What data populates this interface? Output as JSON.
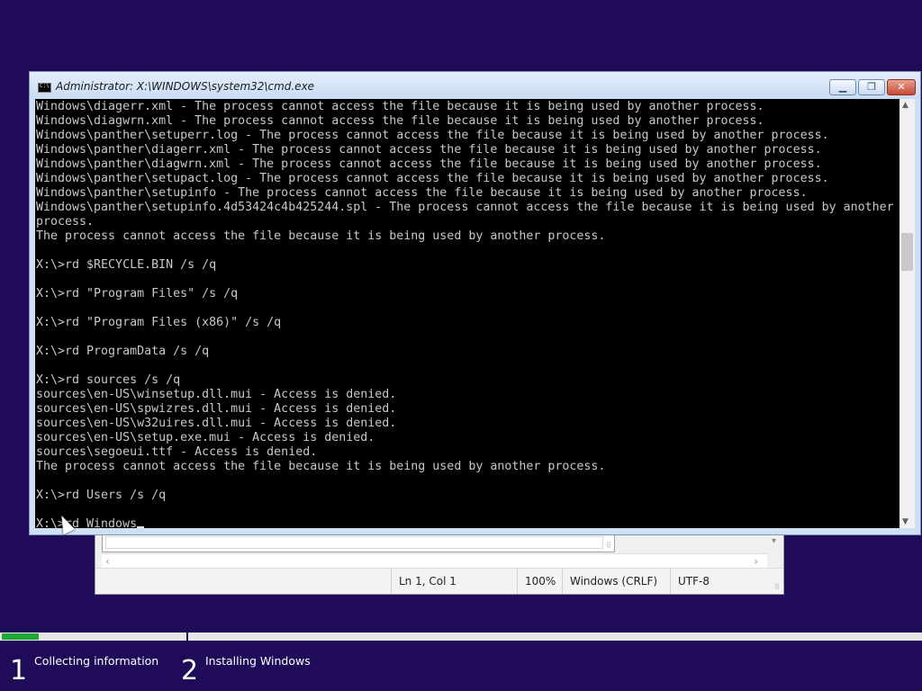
{
  "notepad": {
    "status": {
      "position": "Ln 1, Col 1",
      "zoom": "100%",
      "line_ending": "Windows (CRLF)",
      "encoding": "UTF-8"
    }
  },
  "cmd": {
    "title": "Administrator: X:\\WINDOWS\\system32\\cmd.exe",
    "lines": [
      "Windows\\diagerr.xml - The process cannot access the file because it is being used by another process.",
      "Windows\\diagwrn.xml - The process cannot access the file because it is being used by another process.",
      "Windows\\panther\\setuperr.log - The process cannot access the file because it is being used by another process.",
      "Windows\\panther\\diagerr.xml - The process cannot access the file because it is being used by another process.",
      "Windows\\panther\\diagwrn.xml - The process cannot access the file because it is being used by another process.",
      "Windows\\panther\\setupact.log - The process cannot access the file because it is being used by another process.",
      "Windows\\panther\\setupinfo - The process cannot access the file because it is being used by another process.",
      "Windows\\panther\\setupinfo.4d53424c4b425244.spl - The process cannot access the file because it is being used by another",
      "process.",
      "The process cannot access the file because it is being used by another process.",
      "",
      "X:\\>rd $RECYCLE.BIN /s /q",
      "",
      "X:\\>rd \"Program Files\" /s /q",
      "",
      "X:\\>rd \"Program Files (x86)\" /s /q",
      "",
      "X:\\>rd ProgramData /s /q",
      "",
      "X:\\>rd sources /s /q",
      "sources\\en-US\\winsetup.dll.mui - Access is denied.",
      "sources\\en-US\\spwizres.dll.mui - Access is denied.",
      "sources\\en-US\\w32uires.dll.mui - Access is denied.",
      "sources\\en-US\\setup.exe.mui - Access is denied.",
      "sources\\segoeui.ttf - Access is denied.",
      "The process cannot access the file because it is being used by another process.",
      "",
      "X:\\>rd Users /s /q",
      ""
    ],
    "current_input": "X:\\>rd Windows"
  },
  "setup": {
    "progress": 0.2,
    "steps": [
      {
        "number": "1",
        "label": "Collecting information"
      },
      {
        "number": "2",
        "label": "Installing Windows"
      }
    ],
    "accent": "#1fa835",
    "background": "#1f0b57"
  }
}
